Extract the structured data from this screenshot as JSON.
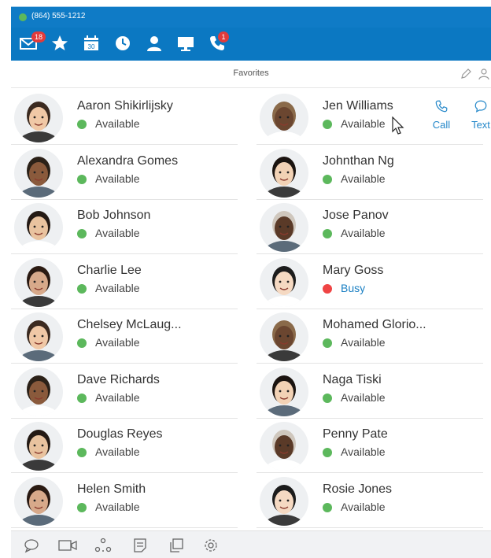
{
  "status_bar": {
    "phone_number": "(864) 555-1212",
    "presence_color": "#5cb85c"
  },
  "nav": {
    "items": [
      {
        "icon": "mail-icon",
        "badge": "18"
      },
      {
        "icon": "star-icon"
      },
      {
        "icon": "calendar-icon",
        "text": "30"
      },
      {
        "icon": "clock-icon"
      },
      {
        "icon": "person-icon"
      },
      {
        "icon": "monitor-icon"
      },
      {
        "icon": "phone-icon",
        "badge": "1"
      }
    ]
  },
  "header": {
    "title": "Favorites"
  },
  "contacts": [
    {
      "name": "Aaron Shikirlijsky",
      "status": "Available"
    },
    {
      "name": "Jen Williams",
      "status": "Available"
    },
    {
      "name": "Alexandra Gomes",
      "status": "Available"
    },
    {
      "name": "Johnthan Ng",
      "status": "Available"
    },
    {
      "name": "Bob Johnson",
      "status": "Available"
    },
    {
      "name": "Jose Panov",
      "status": "Available"
    },
    {
      "name": "Charlie Lee",
      "status": "Available"
    },
    {
      "name": "Mary Goss",
      "status": "Busy"
    },
    {
      "name": "Chelsey McLaug...",
      "status": "Available"
    },
    {
      "name": "Mohamed Glorio...",
      "status": "Available"
    },
    {
      "name": "Dave Richards",
      "status": "Available"
    },
    {
      "name": "Naga Tiski",
      "status": "Available"
    },
    {
      "name": "Douglas Reyes",
      "status": "Available"
    },
    {
      "name": "Penny Pate",
      "status": "Available"
    },
    {
      "name": "Helen Smith",
      "status": "Available"
    },
    {
      "name": "Rosie Jones",
      "status": "Available"
    }
  ],
  "hover_actions": {
    "call_label": "Call",
    "text_label": "Text"
  },
  "bottom_toolbar": {
    "icons": [
      "chat-icon",
      "video-icon",
      "conference-icon",
      "notes-icon",
      "copy-icon",
      "settings-icon"
    ]
  },
  "colors": {
    "accent": "#0b78c2",
    "available": "#5cb85c",
    "busy": "#ef4444",
    "badge": "#e23b3b"
  }
}
